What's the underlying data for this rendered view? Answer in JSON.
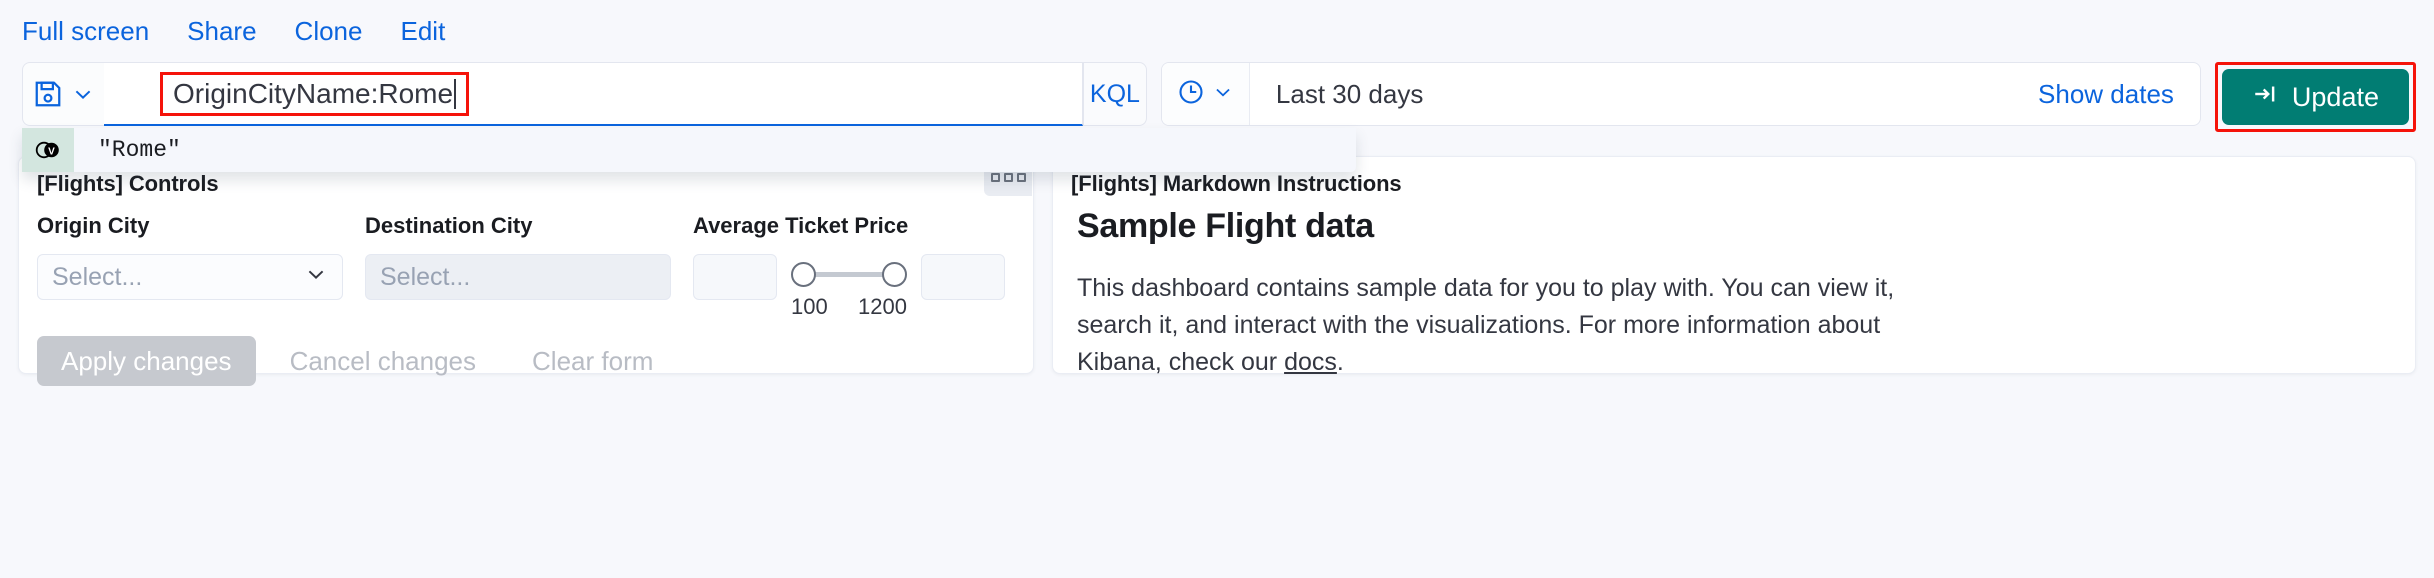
{
  "topnav": {
    "links": [
      {
        "label": "Full screen",
        "name": "full-screen"
      },
      {
        "label": "Share",
        "name": "share"
      },
      {
        "label": "Clone",
        "name": "clone"
      },
      {
        "label": "Edit",
        "name": "edit"
      }
    ]
  },
  "query_bar": {
    "saved_query_icon": "save-icon",
    "query_value": "OriginCityName:Rome",
    "language_label": "KQL",
    "time_icon": "clock-icon",
    "time_range_label": "Last 30 days",
    "show_dates_label": "Show dates",
    "update_label": "Update",
    "update_icon": "refresh-arrow-icon",
    "update_color": "#017d73",
    "highlight_color": "#f5130a",
    "focus_underline_color": "#0b64dd"
  },
  "suggestions": {
    "items": [
      {
        "icon": "value-token-icon",
        "text": "\"Rome\""
      }
    ]
  },
  "panels": {
    "controls": {
      "title": "[Flights] Controls",
      "menu_icon": "context-menu-icon",
      "fields": [
        {
          "label": "Origin City",
          "placeholder": "Select...",
          "type": "select",
          "disabled": false
        },
        {
          "label": "Destination City",
          "placeholder": "Select...",
          "type": "select",
          "disabled": true
        }
      ],
      "range": {
        "label": "Average Ticket Price",
        "min_value": "",
        "max_value": "",
        "min_label": "100",
        "max_label": "1200"
      },
      "actions": {
        "apply_label": "Apply changes",
        "cancel_label": "Cancel changes",
        "clear_label": "Clear form"
      }
    },
    "markdown": {
      "title": "[Flights] Markdown Instructions",
      "heading": "Sample Flight data",
      "paragraph_before": "This dashboard contains sample data for you to play with. You can view it, search it, and interact with the visualizations. For more information about Kibana, check our ",
      "link_label": "docs",
      "paragraph_after": "."
    }
  }
}
